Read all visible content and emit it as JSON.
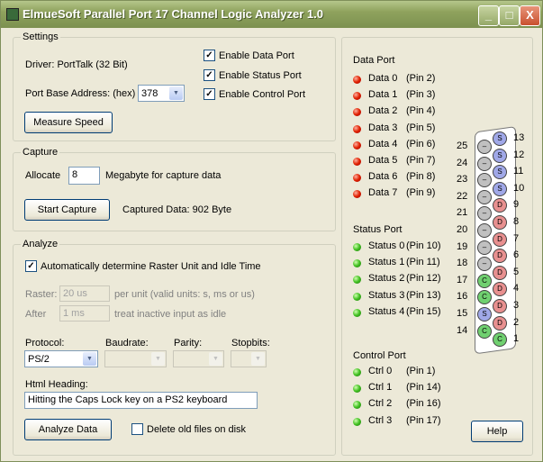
{
  "window": {
    "title": "ElmueSoft  Parallel Port  17 Channel   Logic Analyzer 1.0",
    "minimize": "_",
    "maximize": "□",
    "close": "X"
  },
  "settings": {
    "legend": "Settings",
    "driver": "Driver: PortTalk (32 Bit)",
    "port_label": "Port Base Address: (hex)",
    "port_value": "378",
    "enable_data": "Enable Data Port",
    "enable_status": "Enable Status Port",
    "enable_control": "Enable Control Port",
    "check": "✓",
    "measure": "Measure Speed"
  },
  "capture": {
    "legend": "Capture",
    "allocate": "Allocate",
    "allocate_value": "8",
    "mb_label": "Megabyte for capture data",
    "start": "Start Capture",
    "captured": "Captured Data:  902 Byte"
  },
  "analyze": {
    "legend": "Analyze",
    "auto": "Automatically determine Raster Unit and Idle Time",
    "raster": "Raster:",
    "raster_value": "20 us",
    "raster_unit": "per unit (valid units: s, ms or us)",
    "after": "After",
    "after_value": "1 ms",
    "after_text": "treat inactive input as idle",
    "protocol": "Protocol:",
    "protocol_value": "PS/2",
    "baudrate": "Baudrate:",
    "parity": "Parity:",
    "stopbits": "Stopbits:",
    "heading_label": "Html Heading:",
    "heading_value": "Hitting the Caps Lock key on a PS2 keyboard",
    "analyze_btn": "Analyze Data",
    "delete_old": "Delete old files on disk"
  },
  "ports": {
    "data_title": "Data Port",
    "data": [
      {
        "n": "Data 0",
        "p": "(Pin 2)"
      },
      {
        "n": "Data 1",
        "p": "(Pin 3)"
      },
      {
        "n": "Data 2",
        "p": "(Pin 4)"
      },
      {
        "n": "Data 3",
        "p": "(Pin 5)"
      },
      {
        "n": "Data 4",
        "p": "(Pin 6)"
      },
      {
        "n": "Data 5",
        "p": "(Pin 7)"
      },
      {
        "n": "Data 6",
        "p": "(Pin 8)"
      },
      {
        "n": "Data 7",
        "p": "(Pin 9)"
      }
    ],
    "status_title": "Status Port",
    "status": [
      {
        "n": "Status 0",
        "p": "(Pin 10)"
      },
      {
        "n": "Status 1",
        "p": "(Pin 11)"
      },
      {
        "n": "Status 2",
        "p": "(Pin 12)"
      },
      {
        "n": "Status 3",
        "p": "(Pin 13)"
      },
      {
        "n": "Status 4",
        "p": "(Pin 15)"
      }
    ],
    "control_title": "Control Port",
    "control": [
      {
        "n": "Ctrl 0",
        "p": "(Pin 1)"
      },
      {
        "n": "Ctrl 1",
        "p": "(Pin 14)"
      },
      {
        "n": "Ctrl 2",
        "p": "(Pin 16)"
      },
      {
        "n": "Ctrl 3",
        "p": "(Pin 17)"
      }
    ]
  },
  "connector": {
    "right": [
      {
        "pin": "13",
        "t": "S"
      },
      {
        "pin": "12",
        "t": "S"
      },
      {
        "pin": "11",
        "t": "S"
      },
      {
        "pin": "10",
        "t": "S"
      },
      {
        "pin": "9",
        "t": "D"
      },
      {
        "pin": "8",
        "t": "D"
      },
      {
        "pin": "7",
        "t": "D"
      },
      {
        "pin": "6",
        "t": "D"
      },
      {
        "pin": "5",
        "t": "D"
      },
      {
        "pin": "4",
        "t": "D"
      },
      {
        "pin": "3",
        "t": "D"
      },
      {
        "pin": "2",
        "t": "D"
      },
      {
        "pin": "1",
        "t": "C"
      }
    ],
    "left": [
      {
        "pin": "25",
        "t": "–"
      },
      {
        "pin": "24",
        "t": "–"
      },
      {
        "pin": "23",
        "t": "–"
      },
      {
        "pin": "22",
        "t": "–"
      },
      {
        "pin": "21",
        "t": "–"
      },
      {
        "pin": "20",
        "t": "–"
      },
      {
        "pin": "19",
        "t": "–"
      },
      {
        "pin": "18",
        "t": "–"
      },
      {
        "pin": "17",
        "t": "C"
      },
      {
        "pin": "16",
        "t": "C"
      },
      {
        "pin": "15",
        "t": "S"
      },
      {
        "pin": "14",
        "t": "C"
      }
    ],
    "colors": {
      "S": "#a0a8e8",
      "D": "#e89090",
      "C": "#70d070",
      "–": "#c0c0c0"
    }
  },
  "help": "Help"
}
